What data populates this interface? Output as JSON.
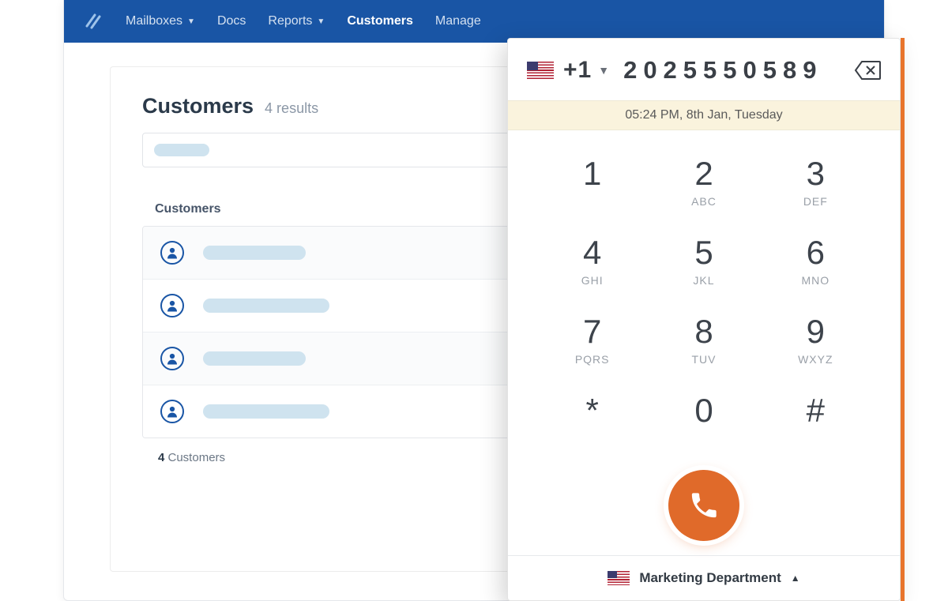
{
  "nav": {
    "items": [
      {
        "label": "Mailboxes",
        "has_dropdown": true
      },
      {
        "label": "Docs",
        "has_dropdown": false
      },
      {
        "label": "Reports",
        "has_dropdown": true
      },
      {
        "label": "Customers",
        "has_dropdown": false,
        "active": true
      },
      {
        "label": "Manage",
        "has_dropdown": true
      }
    ]
  },
  "page": {
    "title": "Customers",
    "results_text": "4 results",
    "section_label": "Customers",
    "footer_count": "4",
    "footer_word": " Customers"
  },
  "dialer": {
    "country_code": "+1",
    "number": "2025550589",
    "timestamp": "05:24 PM, 8th Jan, Tuesday",
    "keys": [
      {
        "digit": "1",
        "letters": ""
      },
      {
        "digit": "2",
        "letters": "ABC"
      },
      {
        "digit": "3",
        "letters": "DEF"
      },
      {
        "digit": "4",
        "letters": "GHI"
      },
      {
        "digit": "5",
        "letters": "JKL"
      },
      {
        "digit": "6",
        "letters": "MNO"
      },
      {
        "digit": "7",
        "letters": "PQRS"
      },
      {
        "digit": "8",
        "letters": "TUV"
      },
      {
        "digit": "9",
        "letters": "WXYZ"
      },
      {
        "digit": "*",
        "letters": ""
      },
      {
        "digit": "0",
        "letters": ""
      },
      {
        "digit": "#",
        "letters": ""
      }
    ],
    "department": "Marketing Department"
  }
}
